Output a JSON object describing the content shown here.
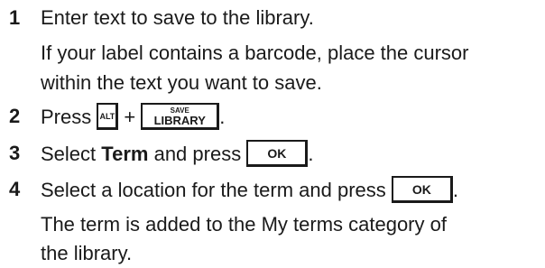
{
  "steps": [
    {
      "number": "1",
      "text": "Enter text to save to the library.",
      "note": [
        "If your label contains a barcode, place the cursor",
        "within the text you want to save."
      ]
    },
    {
      "number": "2",
      "prefix": "Press",
      "plus": "+",
      "suffix": ".",
      "key_alt": "ALT",
      "key_save_top": "SAVE",
      "key_save_bottom": "LIBRARY"
    },
    {
      "number": "3",
      "prefix": "Select",
      "bold_word": "Term",
      "middle": "and press",
      "key_ok": "OK",
      "suffix": "."
    },
    {
      "number": "4",
      "text": "Select a location for the term and press",
      "key_ok": "OK",
      "suffix": ".",
      "note": [
        "The term is added to the My terms category of",
        "the library."
      ]
    }
  ]
}
